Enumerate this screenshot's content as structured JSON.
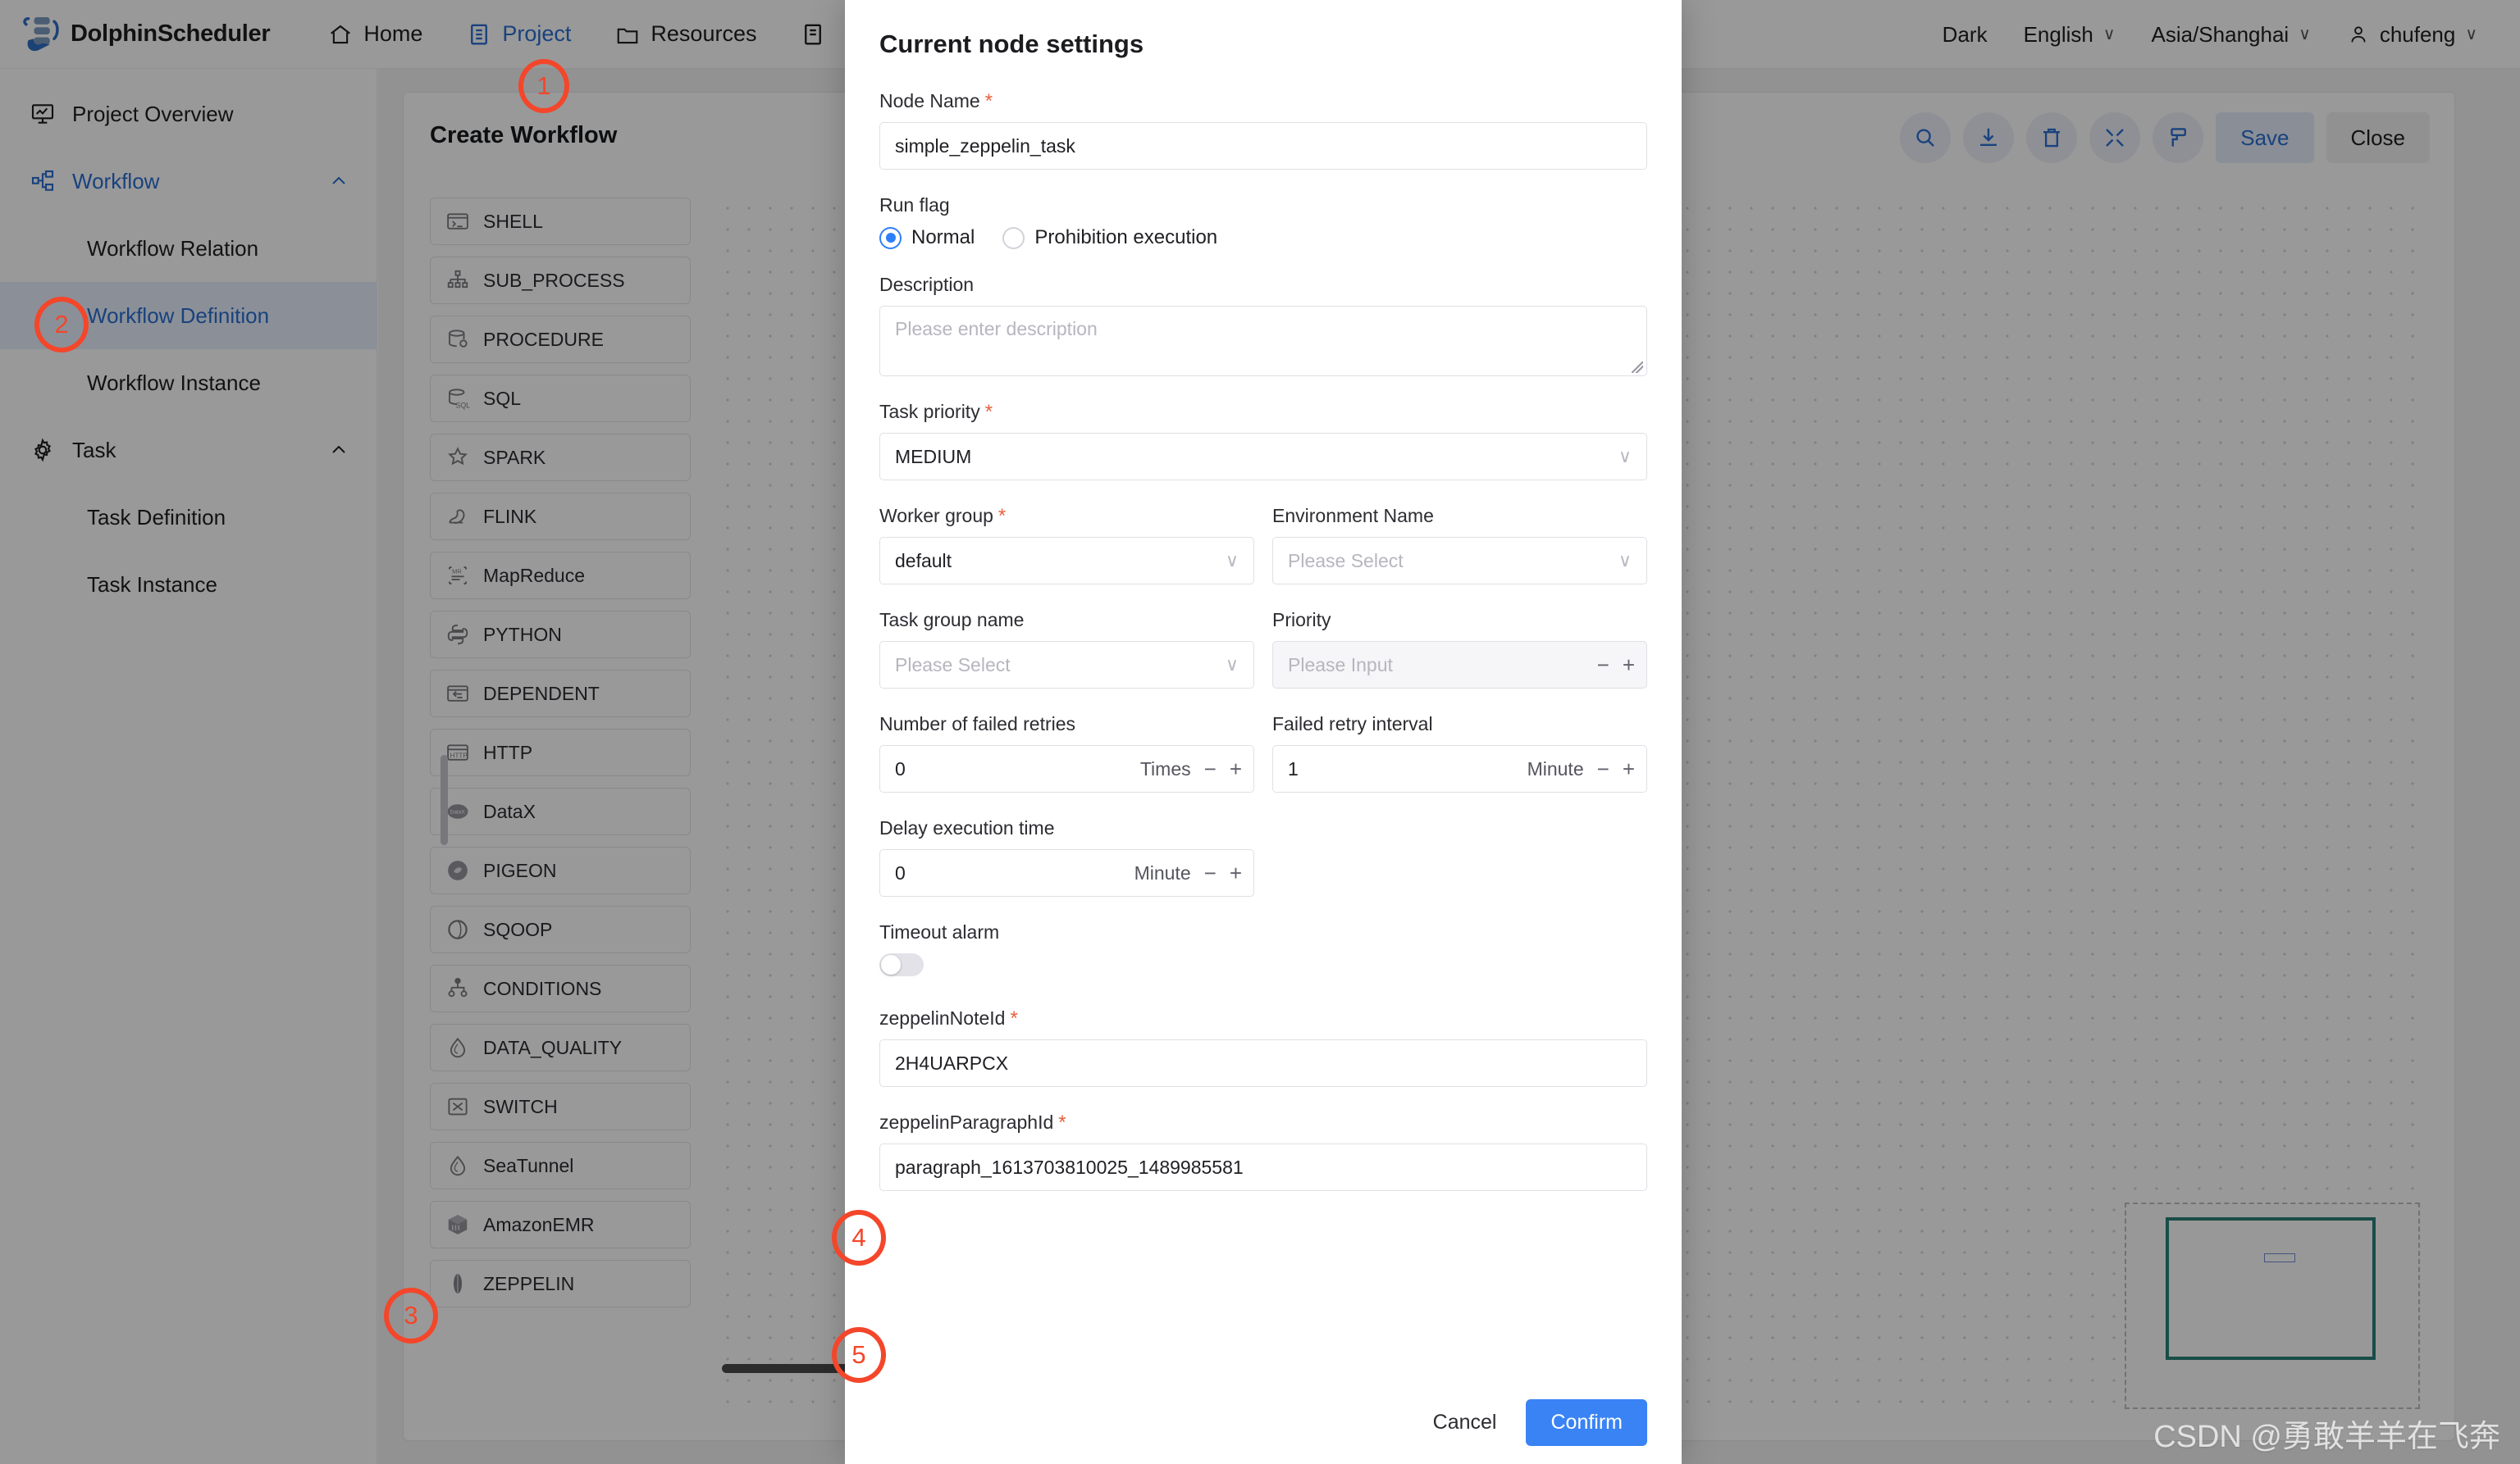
{
  "topbar": {
    "brand": "DolphinScheduler",
    "nav": [
      {
        "label": "Home",
        "icon": "home-icon",
        "active": false
      },
      {
        "label": "Project",
        "icon": "project-icon",
        "active": true
      },
      {
        "label": "Resources",
        "icon": "folder-icon",
        "active": false
      }
    ],
    "right": {
      "theme_label": "Dark",
      "language_label": "English",
      "timezone_label": "Asia/Shanghai",
      "user_label": "chufeng",
      "caret": "∨",
      "user_icon": "user-icon"
    }
  },
  "sidebar": {
    "items": [
      {
        "label": "Project Overview",
        "icon": "overview-icon",
        "type": "item"
      },
      {
        "label": "Workflow",
        "icon": "workflow-icon",
        "type": "group",
        "expanded": true
      },
      {
        "label": "Workflow Relation",
        "type": "sub"
      },
      {
        "label": "Workflow Definition",
        "type": "sub",
        "active": true
      },
      {
        "label": "Workflow Instance",
        "type": "sub"
      },
      {
        "label": "Task",
        "icon": "gear-icon",
        "type": "group",
        "expanded": true
      },
      {
        "label": "Task Definition",
        "type": "sub"
      },
      {
        "label": "Task Instance",
        "type": "sub"
      }
    ]
  },
  "workflow": {
    "title": "Create Workflow",
    "toolbar": {
      "icons": [
        "search-icon",
        "download-icon",
        "trash-icon",
        "fullscreen-icon",
        "format-icon"
      ],
      "save_label": "Save",
      "close_label": "Close"
    },
    "task_types": [
      {
        "label": "SHELL",
        "icon": "shell-icon"
      },
      {
        "label": "SUB_PROCESS",
        "icon": "subprocess-icon"
      },
      {
        "label": "PROCEDURE",
        "icon": "procedure-icon"
      },
      {
        "label": "SQL",
        "icon": "sql-icon"
      },
      {
        "label": "SPARK",
        "icon": "spark-icon"
      },
      {
        "label": "FLINK",
        "icon": "flink-icon"
      },
      {
        "label": "MapReduce",
        "icon": "mapreduce-icon"
      },
      {
        "label": "PYTHON",
        "icon": "python-icon"
      },
      {
        "label": "DEPENDENT",
        "icon": "dependent-icon"
      },
      {
        "label": "HTTP",
        "icon": "http-icon"
      },
      {
        "label": "DataX",
        "icon": "datax-icon"
      },
      {
        "label": "PIGEON",
        "icon": "pigeon-icon"
      },
      {
        "label": "SQOOP",
        "icon": "sqoop-icon"
      },
      {
        "label": "CONDITIONS",
        "icon": "conditions-icon"
      },
      {
        "label": "DATA_QUALITY",
        "icon": "dataquality-icon"
      },
      {
        "label": "SWITCH",
        "icon": "switch-icon"
      },
      {
        "label": "SeaTunnel",
        "icon": "seatunnel-icon"
      },
      {
        "label": "AmazonEMR",
        "icon": "amazonemr-icon"
      },
      {
        "label": "ZEPPELIN",
        "icon": "zeppelin-icon"
      }
    ]
  },
  "modal": {
    "title": "Current node settings",
    "node_name": {
      "label": "Node Name",
      "required": true,
      "value": "simple_zeppelin_task"
    },
    "run_flag": {
      "label": "Run flag",
      "options": [
        {
          "label": "Normal",
          "selected": true
        },
        {
          "label": "Prohibition execution",
          "selected": false
        }
      ]
    },
    "description": {
      "label": "Description",
      "placeholder": "Please enter description",
      "value": ""
    },
    "task_priority": {
      "label": "Task priority",
      "required": true,
      "value": "MEDIUM"
    },
    "worker_group": {
      "label": "Worker group",
      "required": true,
      "value": "default"
    },
    "environment_name": {
      "label": "Environment Name",
      "placeholder": "Please Select",
      "value": ""
    },
    "task_group_name": {
      "label": "Task group name",
      "placeholder": "Please Select",
      "value": ""
    },
    "priority": {
      "label": "Priority",
      "placeholder": "Please Input",
      "value": "",
      "disabled": true,
      "minus": "−",
      "plus": "+"
    },
    "failed_retries": {
      "label": "Number of failed retries",
      "value": "0",
      "unit": "Times",
      "minus": "−",
      "plus": "+"
    },
    "failed_retry_interval": {
      "label": "Failed retry interval",
      "value": "1",
      "unit": "Minute",
      "minus": "−",
      "plus": "+"
    },
    "delay_execution_time": {
      "label": "Delay execution time",
      "value": "0",
      "unit": "Minute",
      "minus": "−",
      "plus": "+"
    },
    "timeout_alarm": {
      "label": "Timeout alarm",
      "on": false
    },
    "zeppelin_note_id": {
      "label": "zeppelinNoteId",
      "required": true,
      "value": "2H4UARPCX"
    },
    "zeppelin_paragraph_id": {
      "label": "zeppelinParagraphId",
      "required": true,
      "value": "paragraph_1613703810025_1489985581"
    },
    "cancel_label": "Cancel",
    "confirm_label": "Confirm"
  },
  "annotations": {
    "steps": [
      {
        "number": "1"
      },
      {
        "number": "2"
      },
      {
        "number": "3"
      },
      {
        "number": "4"
      },
      {
        "number": "5"
      }
    ]
  },
  "watermark": "CSDN @勇敢羊羊在飞奔",
  "colors": {
    "accent_blue": "#2a6ed3",
    "confirm_blue": "#3a83f5",
    "annotation_red": "#f4462a",
    "minimap_teal": "#2b8078"
  }
}
